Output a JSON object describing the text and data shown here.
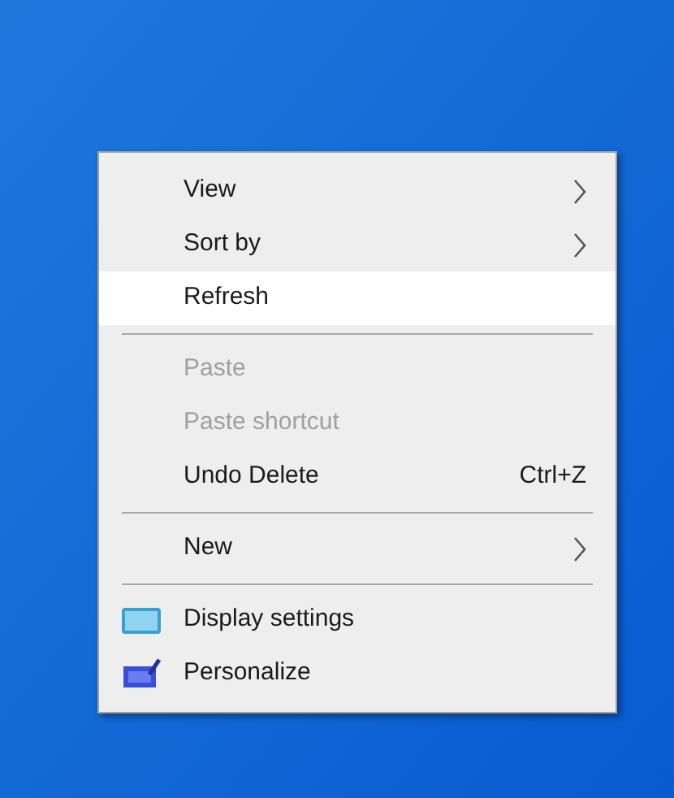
{
  "context_menu": {
    "items": [
      {
        "kind": "item",
        "label": "View",
        "disabled": false,
        "selected": false,
        "submenu": true
      },
      {
        "kind": "item",
        "label": "Sort by",
        "disabled": false,
        "selected": false,
        "submenu": true
      },
      {
        "kind": "item",
        "label": "Refresh",
        "disabled": false,
        "selected": true,
        "submenu": false
      },
      {
        "kind": "separator"
      },
      {
        "kind": "item",
        "label": "Paste",
        "disabled": true,
        "selected": false,
        "submenu": false
      },
      {
        "kind": "item",
        "label": "Paste shortcut",
        "disabled": true,
        "selected": false,
        "submenu": false
      },
      {
        "kind": "item",
        "label": "Undo Delete",
        "shortcut": "Ctrl+Z",
        "disabled": false,
        "selected": false,
        "submenu": false
      },
      {
        "kind": "separator"
      },
      {
        "kind": "item",
        "label": "New",
        "disabled": false,
        "selected": false,
        "submenu": true
      },
      {
        "kind": "separator"
      },
      {
        "kind": "monitor_item",
        "label": "Display settings",
        "disabled": false,
        "selected": false,
        "submenu": false
      },
      {
        "kind": "brush_item",
        "label": "Personalize",
        "disabled": false,
        "selected": false,
        "submenu": false
      }
    ]
  }
}
